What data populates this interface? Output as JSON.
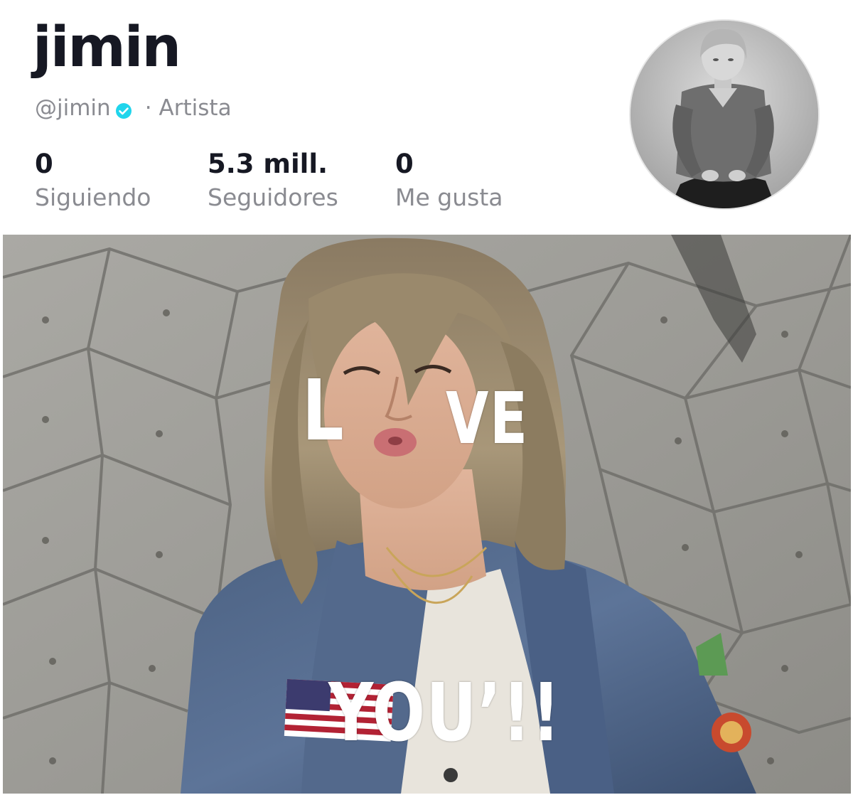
{
  "profile": {
    "display_name": "jimin",
    "handle": "@jimin",
    "separator": "·",
    "category": "Artista",
    "verified_icon": "verified-badge-icon",
    "colors": {
      "name": "#161823",
      "secondary_text": "#8a8b91",
      "verified": "#20d5ec"
    }
  },
  "stats": {
    "following": {
      "value": "0",
      "label": "Siguiendo"
    },
    "followers": {
      "value": "5.3 mill.",
      "label": "Seguidores"
    },
    "likes": {
      "value": "0",
      "label": "Me gusta"
    }
  },
  "media": {
    "overlay_line1_part1": "L",
    "overlay_line1_part2": "VE",
    "overlay_line2": "YOU’!!"
  }
}
